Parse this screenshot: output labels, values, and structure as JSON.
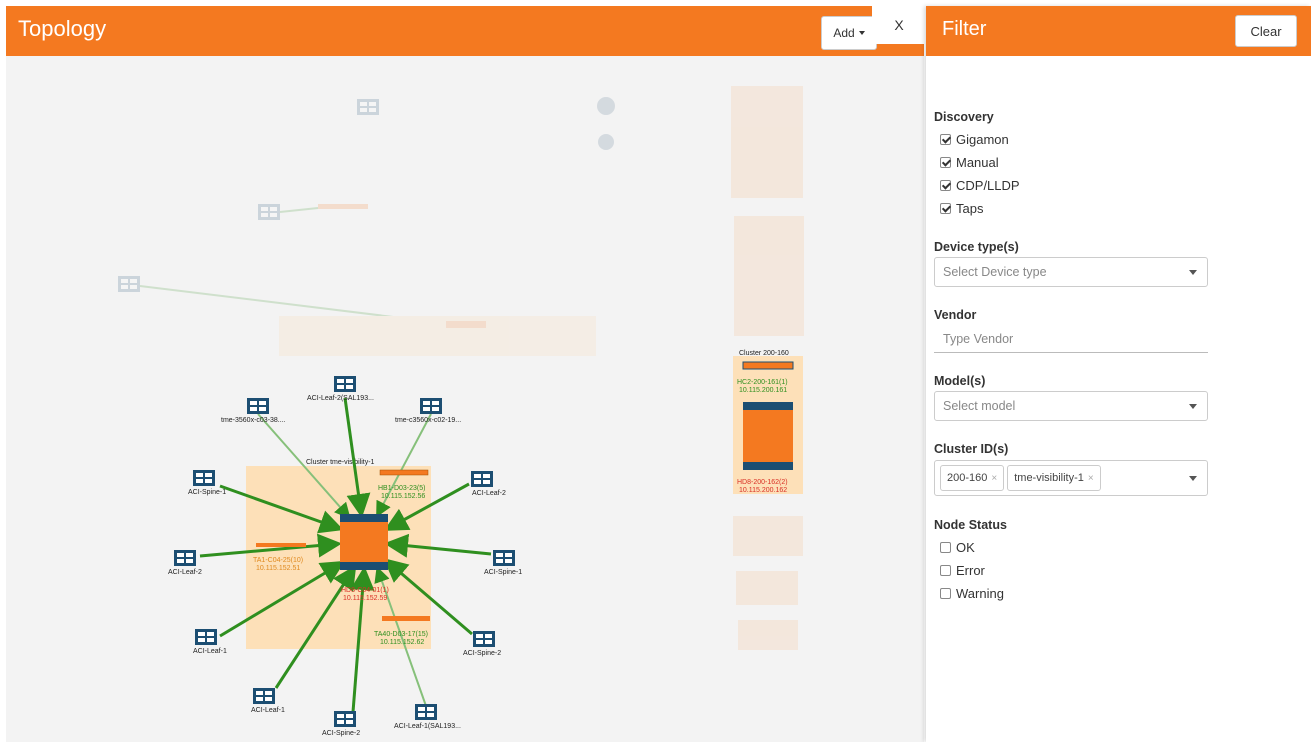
{
  "topology": {
    "title": "Topology",
    "add_label": "Add",
    "close_label": "X"
  },
  "graph": {
    "cluster_main_label": "Cluster tme-visibility-1",
    "cluster_side_label": "Cluster 200-160",
    "hc_label": "HC2-200-161(1)",
    "hc_ip": "10.115.200.161",
    "hd8_side_label": "HD8-200-162(2)",
    "hd8_side_ip": "10.115.200.162",
    "hb_label": "HB1-D03-23(5)",
    "hb_ip": "10.115.152.56",
    "ta1_label": "TA1-C04-25(10)",
    "ta1_ip": "10.115.152.51",
    "hd8_label": "HD8-C04-01(1)",
    "hd8_ip": "10.115.152.59",
    "ta40_label": "TA40-D03-17(15)",
    "ta40_ip": "10.115.152.62",
    "switches": [
      "ACI-Leaf-2(SAL193...",
      "tme-3560x-c03-38....",
      "tme-c3560x-c02-19...",
      "ACI-Spine-1",
      "ACI-Leaf-2",
      "ACI-Leaf-2",
      "ACI-Spine-1",
      "ACI-Leaf-1",
      "ACI-Spine-2",
      "ACI-Leaf-1",
      "ACI-Spine-2",
      "ACI-Leaf-1(SAL193..."
    ]
  },
  "filter": {
    "title": "Filter",
    "clear_label": "Clear",
    "discovery": {
      "title": "Discovery",
      "options": [
        {
          "label": "Gigamon",
          "checked": true
        },
        {
          "label": "Manual",
          "checked": true
        },
        {
          "label": "CDP/LLDP",
          "checked": true
        },
        {
          "label": "Taps",
          "checked": true
        }
      ]
    },
    "device_type": {
      "title": "Device type(s)",
      "placeholder": "Select Device type"
    },
    "vendor": {
      "title": "Vendor",
      "placeholder": "Type Vendor"
    },
    "model": {
      "title": "Model(s)",
      "placeholder": "Select model"
    },
    "cluster": {
      "title": "Cluster ID(s)",
      "tags": [
        "200-160",
        "tme-visibility-1"
      ],
      "tag_remove": "×"
    },
    "node_status": {
      "title": "Node Status",
      "options": [
        {
          "label": "OK",
          "checked": false
        },
        {
          "label": "Error",
          "checked": false
        },
        {
          "label": "Warning",
          "checked": false
        }
      ]
    }
  },
  "colors": {
    "accent": "#f47920",
    "switch_blue": "#1c4e72",
    "link_green": "#2f8f1f",
    "cluster_bg": "#fde0b8"
  }
}
